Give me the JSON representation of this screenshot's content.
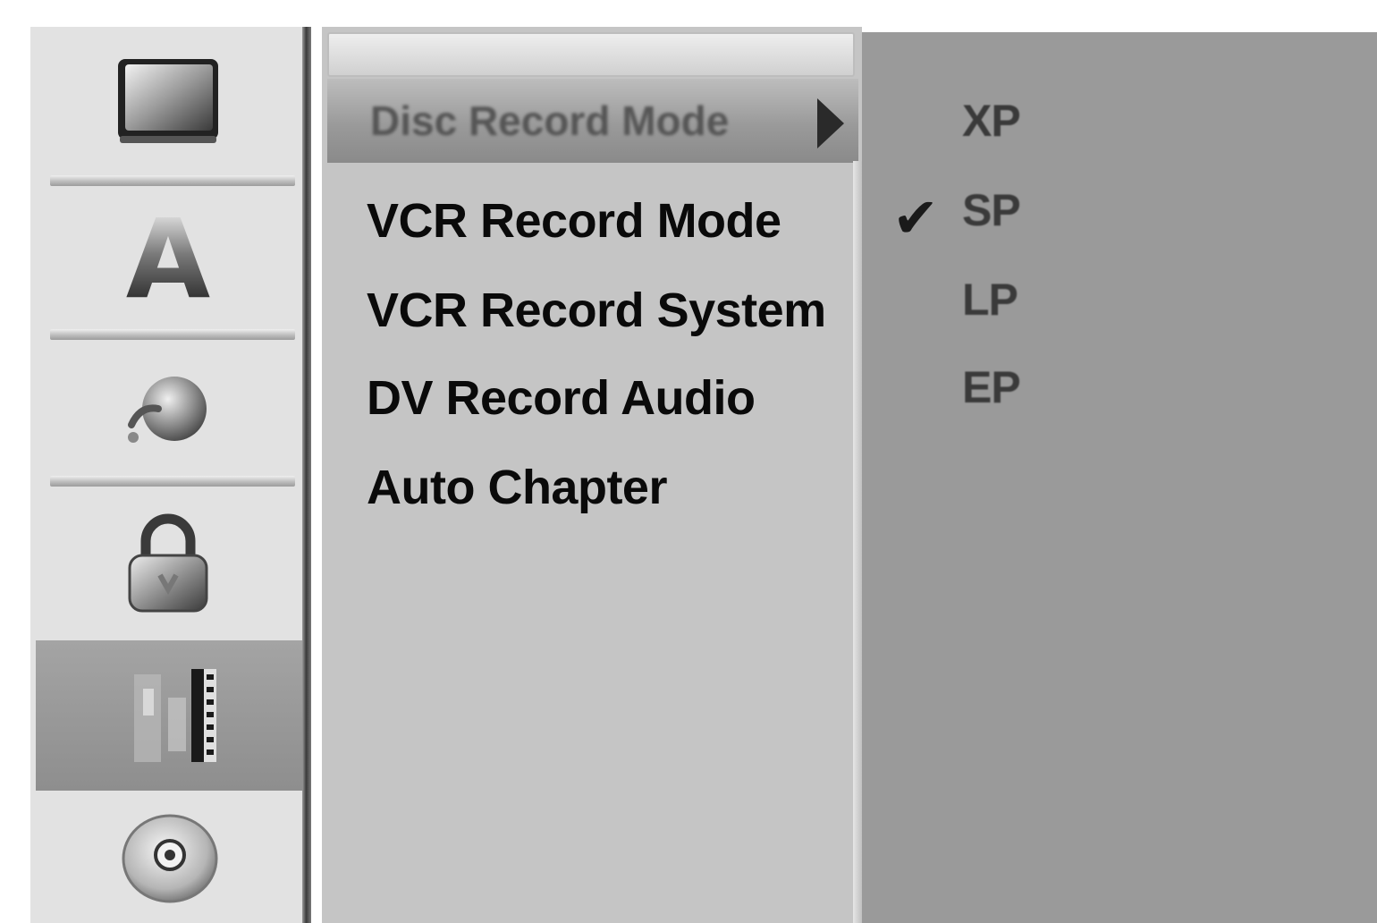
{
  "sidebar": {
    "items": [
      {
        "icon": "tv-screen-icon",
        "label": ""
      },
      {
        "icon": "letter-a-icon",
        "letter": "A"
      },
      {
        "icon": "sound-sphere-icon"
      },
      {
        "icon": "lock-icon"
      },
      {
        "icon": "record-film-icon",
        "selected": true
      },
      {
        "icon": "disc-icon"
      }
    ]
  },
  "menu": {
    "highlighted": {
      "label": "Disc Record Mode"
    },
    "items": [
      {
        "label": "VCR Record Mode"
      },
      {
        "label": "VCR Record System"
      },
      {
        "label": "DV Record Audio"
      },
      {
        "label": "Auto Chapter"
      }
    ]
  },
  "options": {
    "items": [
      {
        "label": "XP"
      },
      {
        "label": "SP"
      },
      {
        "label": "LP"
      },
      {
        "label": "EP"
      }
    ],
    "selected_index": 1,
    "check_glyph": "✔"
  }
}
